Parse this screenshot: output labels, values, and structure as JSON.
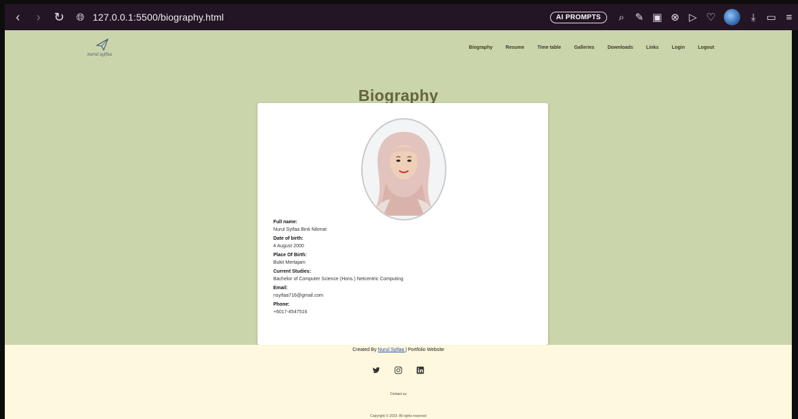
{
  "browser": {
    "url": "127.0.0.1:5500/biography.html",
    "ai_prompts_label": "AI PROMPTS"
  },
  "site": {
    "logo_text": "nurul syifaa",
    "menu": [
      "Biography",
      "Resume",
      "Time table",
      "Galleries",
      "Downloads",
      "Links",
      "Login",
      "Logout"
    ]
  },
  "page": {
    "title": "Biography"
  },
  "bio": {
    "fields": [
      {
        "label": "Full name:",
        "value": "Nurul Syifaa Binti Nikmat"
      },
      {
        "label": "Date of birth:",
        "value": "4 August 2000"
      },
      {
        "label": "Place Of Birth:",
        "value": "Bukit Mertajam"
      },
      {
        "label": "Current Studies:",
        "value": "Bachelor of Computer Science (Hons.) Netcentric Computing"
      },
      {
        "label": "Email:",
        "value": "nsyifaa716@gmail.com"
      },
      {
        "label": "Phone:",
        "value": "+6017-4547516"
      }
    ]
  },
  "footer": {
    "created_prefix": "Created By ",
    "author_link": "Nurul Syifaa ",
    "created_suffix": "| Portfolio Website",
    "contact": "Contact us",
    "copyright": "Copyright © 2023- All rights reserved"
  },
  "colors": {
    "page_bg": "#cbd5ab",
    "footer_bg": "#fdf8de",
    "title": "#646440",
    "chrome_bg": "#231523"
  }
}
